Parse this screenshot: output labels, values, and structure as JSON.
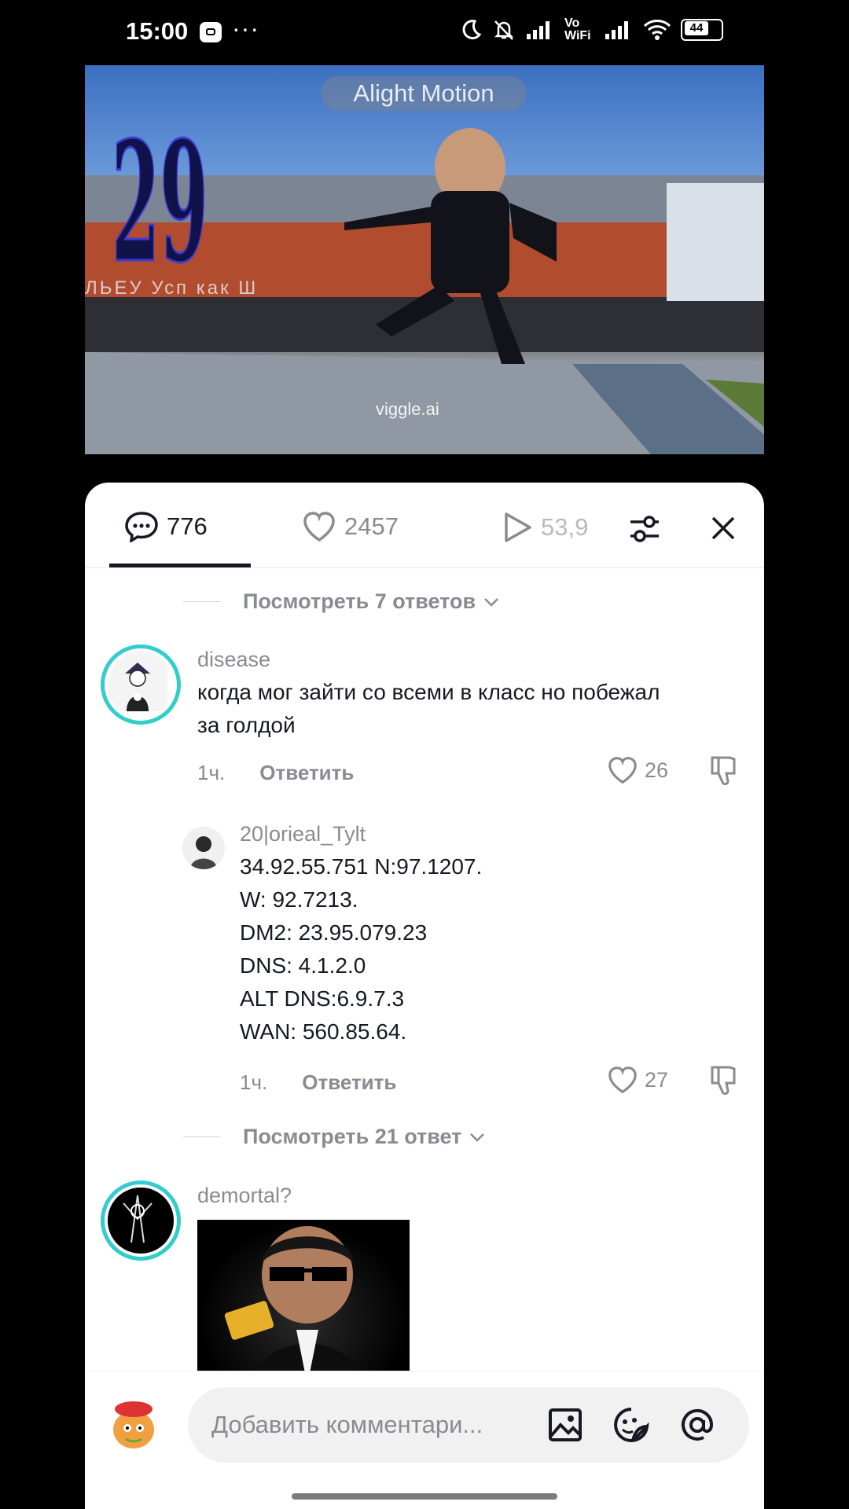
{
  "status_bar": {
    "time": "15:00",
    "dots": "···",
    "network": "Vo WiFi",
    "battery": "44"
  },
  "video": {
    "watermark": "Alight Motion",
    "overlay_number": "29",
    "sign_text": "ЛЬЕУ Усп        как   Ш",
    "footer_watermark": "viggle.ai"
  },
  "tabs": {
    "comments_count": "776",
    "likes_count": "2457",
    "views_count": "53,9"
  },
  "comments": {
    "view_replies_1": "Посмотреть 7 ответов",
    "c1": {
      "username": "disease",
      "text": "когда мог зайти со всеми в класс но побежал\nза голдой",
      "time": "1ч.",
      "reply_label": "Ответить",
      "likes": "26"
    },
    "r1": {
      "username": "20|orieal_Tylt",
      "text": "34.92.55.751 N:97.1207.\nW: 92.7213.\nDM2: 23.95.079.23\nDNS: 4.1.2.0\nALT DNS:6.9.7.3\nWAN: 560.85.64.",
      "time": "1ч.",
      "reply_label": "Ответить",
      "likes": "27"
    },
    "view_replies_2": "Посмотреть 21 ответ",
    "c2": {
      "username": "demortal?"
    }
  },
  "input": {
    "placeholder": "Добавить комментари..."
  }
}
